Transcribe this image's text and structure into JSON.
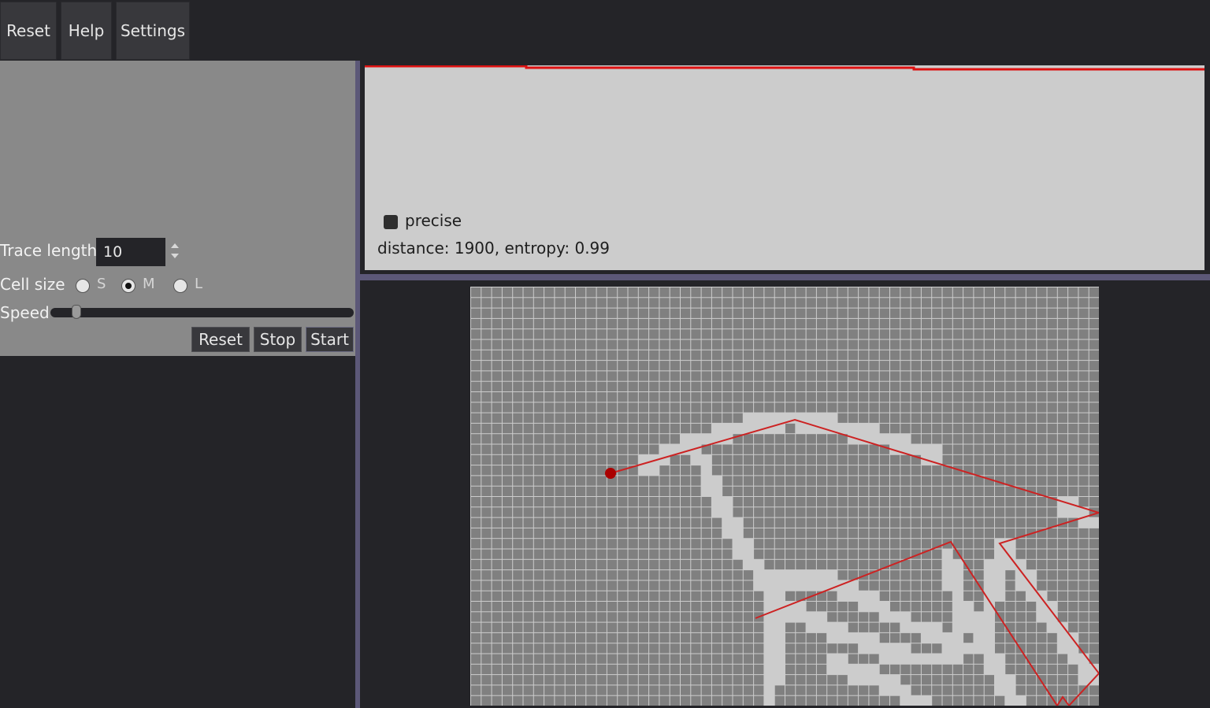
{
  "menu": {
    "reset": "Reset",
    "help": "Help",
    "settings": "Settings"
  },
  "controls": {
    "trace_length_label": "Trace length",
    "trace_length_value": "10",
    "cell_size_label": "Cell size",
    "cell_size_options": [
      "S",
      "M",
      "L"
    ],
    "cell_size_selected": "M",
    "speed_label": "Speed",
    "speed_level": 0.07,
    "reset_label": "Reset",
    "stop_label": "Stop",
    "start_label": "Start"
  },
  "plot": {
    "precise_label": "precise",
    "precise_checked": true,
    "stats": "distance: 1900, entropy: 0.99",
    "line_color": "#dd1111"
  },
  "colors": {
    "background": "#242428",
    "panel": "#898989",
    "plot_bg": "#cccccc",
    "cell_dark": "#808080",
    "cell_light": "#cccccc",
    "trace": "#cc2222",
    "trace_dot": "#aa0000",
    "splitter": "#5c5878"
  }
}
